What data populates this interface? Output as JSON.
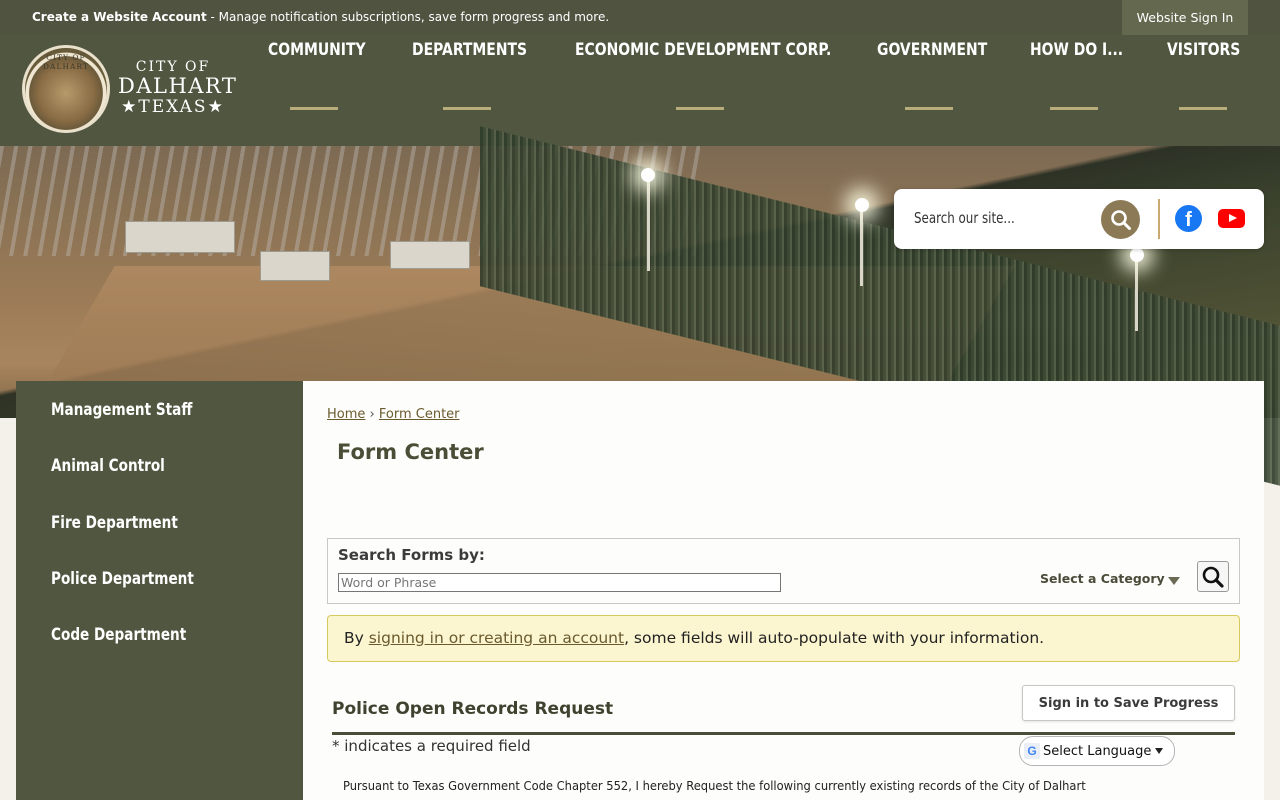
{
  "topbar": {
    "create_account_bold": "Create a Website Account",
    "create_account_rest": " - Manage notification subscriptions, save form progress and more.",
    "website_sign_in": "Website Sign In"
  },
  "brand": {
    "seal_text": "CITY OF DALHART",
    "line1": "CITY OF",
    "line2": "DALHART",
    "line3": "★TEXAS★"
  },
  "nav": {
    "items": [
      "COMMUNITY",
      "DEPARTMENTS",
      "ECONOMIC DEVELOPMENT CORP.",
      "GOVERNMENT",
      "HOW DO I...",
      "VISITORS"
    ]
  },
  "search": {
    "placeholder": "Search our site..."
  },
  "social": {
    "facebook": "f",
    "icons": [
      "search-icon",
      "facebook-icon",
      "youtube-icon"
    ],
    "colors": {
      "facebook": "#1877f2",
      "youtube": "#ff0000",
      "search_button": "#8b7a55"
    }
  },
  "sidebar": {
    "items": [
      "Management Staff",
      "Animal Control",
      "Fire Department",
      "Police Department",
      "Code Department"
    ]
  },
  "breadcrumb": {
    "home": "Home",
    "separator": "›",
    "current": "Form Center"
  },
  "page_title": "Form Center",
  "search_forms": {
    "label": "Search Forms by:",
    "input_placeholder": "Word or Phrase",
    "category_label": "Select a Category"
  },
  "notice": {
    "prefix": "By ",
    "link": "signing in or creating an account",
    "suffix": ", some fields will auto-populate with your information."
  },
  "form": {
    "title": "Police Open Records Request",
    "save_button": "Sign in to Save Progress",
    "required_note": "* indicates a required field",
    "language_select": "Select Language",
    "intro": "Pursuant to Texas Government Code Chapter 552, I hereby Request the following currently existing records of the City of Dalhart"
  },
  "colors": {
    "header_bg": "#515640",
    "topbar_bg": "#4f5340",
    "accent_underline": "#b8ad7a",
    "link": "#6a5a2e",
    "notice_bg": "#fbf6d0"
  }
}
